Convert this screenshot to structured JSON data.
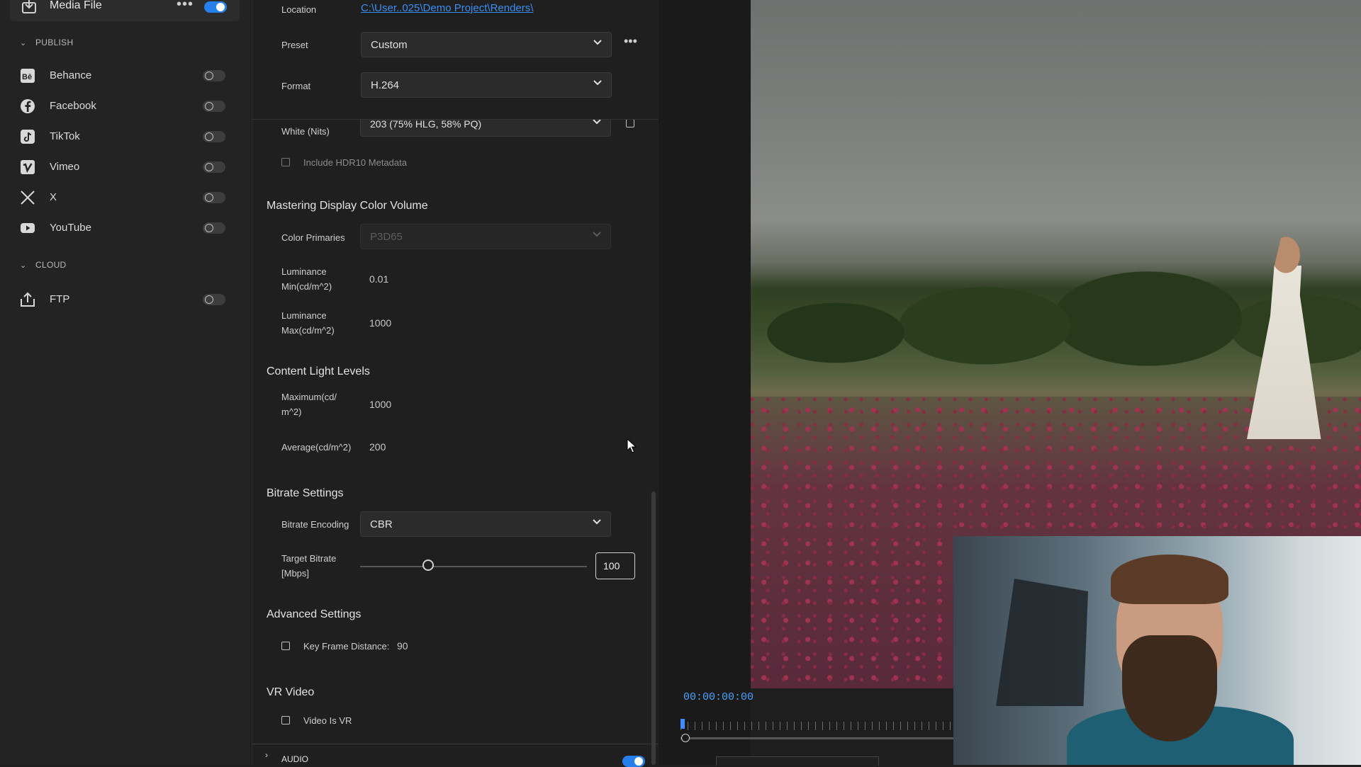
{
  "sidebar": {
    "media_file": {
      "label": "Media File",
      "more": "•••",
      "enabled": true
    },
    "publish": {
      "header": "PUBLISH",
      "items": [
        {
          "label": "Behance",
          "icon": "behance-icon",
          "enabled": false
        },
        {
          "label": "Facebook",
          "icon": "facebook-icon",
          "enabled": false
        },
        {
          "label": "TikTok",
          "icon": "tiktok-icon",
          "enabled": false
        },
        {
          "label": "Vimeo",
          "icon": "vimeo-icon",
          "enabled": false
        },
        {
          "label": "X",
          "icon": "x-icon",
          "enabled": false
        },
        {
          "label": "YouTube",
          "icon": "youtube-icon",
          "enabled": false
        }
      ]
    },
    "cloud": {
      "header": "CLOUD",
      "items": [
        {
          "label": "FTP",
          "icon": "upload-icon",
          "enabled": false
        }
      ]
    }
  },
  "settings": {
    "location": {
      "label": "Location",
      "value": "C:\\User..025\\Demo Project\\Renders\\"
    },
    "preset": {
      "label": "Preset",
      "value": "Custom",
      "more": "•••"
    },
    "format": {
      "label": "Format",
      "value": "H.264"
    },
    "graphics_white": {
      "label": "White (Nits)",
      "value": "203 (75% HLG, 58% PQ)"
    },
    "hdr10": {
      "label": "Include HDR10 Metadata",
      "checked": false
    },
    "mastering": {
      "header": "Mastering Display Color Volume",
      "color_primaries": {
        "label": "Color Primaries",
        "value": "P3D65"
      },
      "lum_min": {
        "label_1": "Luminance",
        "label_2": "Min(cd/m^2)",
        "value": "0.01"
      },
      "lum_max": {
        "label_1": "Luminance",
        "label_2": "Max(cd/m^2)",
        "value": "1000"
      }
    },
    "content_light": {
      "header": "Content Light Levels",
      "maximum": {
        "label_1": "Maximum(cd/",
        "label_2": "m^2)",
        "value": "1000"
      },
      "average": {
        "label": "Average(cd/m^2)",
        "value": "200"
      }
    },
    "bitrate": {
      "header": "Bitrate Settings",
      "encoding": {
        "label": "Bitrate Encoding",
        "value": "CBR"
      },
      "target": {
        "label_1": "Target Bitrate",
        "label_2": "[Mbps]",
        "value": "100",
        "slider_fraction": 0.3
      }
    },
    "advanced": {
      "header": "Advanced Settings",
      "key_frame": {
        "label": "Key Frame Distance:",
        "value": "90",
        "checked": false
      }
    },
    "vr": {
      "header": "VR Video",
      "is_vr": {
        "label": "Video Is VR",
        "checked": false
      }
    },
    "audio": {
      "label": "AUDIO",
      "enabled": true
    }
  },
  "preview": {
    "timecode": "00:00:00:00"
  },
  "colors": {
    "accent": "#2680eb",
    "link": "#3b8df2",
    "timecode": "#4aa3ff"
  }
}
